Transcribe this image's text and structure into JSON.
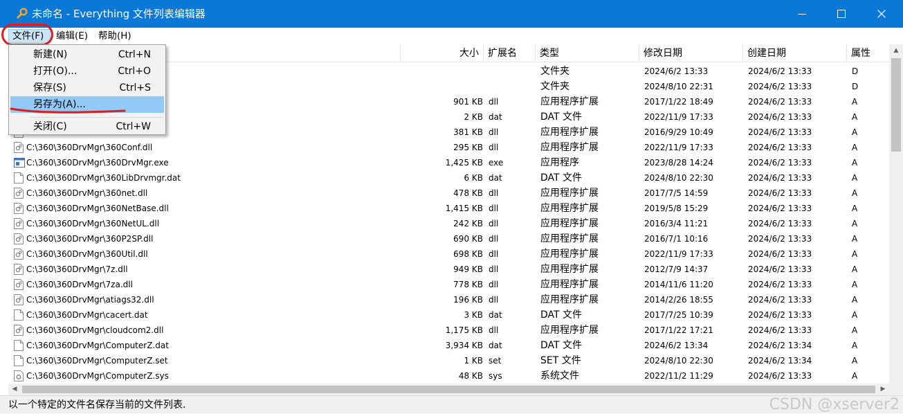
{
  "window": {
    "title": "未命名 - Everything 文件列表编辑器",
    "accent": "#0a78d7"
  },
  "menubar": {
    "items": [
      {
        "label": "文件(F)"
      },
      {
        "label": "编辑(E)"
      },
      {
        "label": "帮助(H)"
      }
    ]
  },
  "file_menu": {
    "items": [
      {
        "label": "新建(N)",
        "shortcut": "Ctrl+N"
      },
      {
        "label": "打开(O)...",
        "shortcut": "Ctrl+O"
      },
      {
        "label": "保存(S)",
        "shortcut": "Ctrl+S"
      },
      {
        "label": "另存为(A)...",
        "shortcut": "",
        "highlighted": true
      },
      {
        "label": "关闭(C)",
        "shortcut": "Ctrl+W"
      }
    ]
  },
  "columns": {
    "size": "大小",
    "ext": "扩展名",
    "type": "类型",
    "modified": "修改日期",
    "created": "创建日期",
    "attr": "属性"
  },
  "rows": [
    {
      "name": "",
      "size": "",
      "ext": "",
      "type": "文件夹",
      "modified": "2024/6/2 13:33",
      "created": "2024/6/2 13:33",
      "attr": "D",
      "icon": "folder-icon"
    },
    {
      "name": "",
      "size": "",
      "ext": "",
      "type": "文件夹",
      "modified": "2024/8/10 22:31",
      "created": "2024/6/2 13:33",
      "attr": "D",
      "icon": "folder-icon"
    },
    {
      "name": "",
      "size": "901 KB",
      "ext": "dll",
      "type": "应用程序扩展",
      "modified": "2017/1/22 18:49",
      "created": "2024/6/2 13:33",
      "attr": "A",
      "icon": "dll-file-icon"
    },
    {
      "name": "",
      "size": "2 KB",
      "ext": "dat",
      "type": "DAT 文件",
      "modified": "2022/11/9 17:33",
      "created": "2024/6/2 13:33",
      "attr": "A",
      "icon": "blank-file-icon"
    },
    {
      "name": "",
      "size": "381 KB",
      "ext": "dll",
      "type": "应用程序扩展",
      "modified": "2016/9/29 10:49",
      "created": "2024/6/2 13:33",
      "attr": "A",
      "icon": "dll-file-icon"
    },
    {
      "name": "C:\\360\\360DrvMgr\\360Conf.dll",
      "size": "295 KB",
      "ext": "dll",
      "type": "应用程序扩展",
      "modified": "2022/11/9 17:33",
      "created": "2024/6/2 13:33",
      "attr": "A",
      "icon": "dll-file-icon"
    },
    {
      "name": "C:\\360\\360DrvMgr\\360DrvMgr.exe",
      "size": "1,425 KB",
      "ext": "exe",
      "type": "应用程序",
      "modified": "2023/8/28 14:24",
      "created": "2024/6/2 13:33",
      "attr": "A",
      "icon": "exe-file-icon"
    },
    {
      "name": "C:\\360\\360DrvMgr\\360LibDrvmgr.dat",
      "size": "6 KB",
      "ext": "dat",
      "type": "DAT 文件",
      "modified": "2024/8/10 22:30",
      "created": "2024/6/2 13:33",
      "attr": "A",
      "icon": "blank-file-icon"
    },
    {
      "name": "C:\\360\\360DrvMgr\\360net.dll",
      "size": "478 KB",
      "ext": "dll",
      "type": "应用程序扩展",
      "modified": "2017/7/5 14:59",
      "created": "2024/6/2 13:33",
      "attr": "A",
      "icon": "dll-file-icon"
    },
    {
      "name": "C:\\360\\360DrvMgr\\360NetBase.dll",
      "size": "1,415 KB",
      "ext": "dll",
      "type": "应用程序扩展",
      "modified": "2019/5/8 15:29",
      "created": "2024/6/2 13:33",
      "attr": "A",
      "icon": "dll-file-icon"
    },
    {
      "name": "C:\\360\\360DrvMgr\\360NetUL.dll",
      "size": "242 KB",
      "ext": "dll",
      "type": "应用程序扩展",
      "modified": "2016/3/4 11:21",
      "created": "2024/6/2 13:33",
      "attr": "A",
      "icon": "dll-file-icon"
    },
    {
      "name": "C:\\360\\360DrvMgr\\360P2SP.dll",
      "size": "690 KB",
      "ext": "dll",
      "type": "应用程序扩展",
      "modified": "2016/7/1 10:16",
      "created": "2024/6/2 13:33",
      "attr": "A",
      "icon": "dll-file-icon"
    },
    {
      "name": "C:\\360\\360DrvMgr\\360Util.dll",
      "size": "698 KB",
      "ext": "dll",
      "type": "应用程序扩展",
      "modified": "2022/11/9 17:33",
      "created": "2024/6/2 13:33",
      "attr": "A",
      "icon": "dll-file-icon"
    },
    {
      "name": "C:\\360\\360DrvMgr\\7z.dll",
      "size": "949 KB",
      "ext": "dll",
      "type": "应用程序扩展",
      "modified": "2012/7/9 14:37",
      "created": "2024/6/2 13:33",
      "attr": "A",
      "icon": "dll-file-icon"
    },
    {
      "name": "C:\\360\\360DrvMgr\\7za.dll",
      "size": "778 KB",
      "ext": "dll",
      "type": "应用程序扩展",
      "modified": "2014/11/6 11:20",
      "created": "2024/6/2 13:33",
      "attr": "A",
      "icon": "dll-file-icon"
    },
    {
      "name": "C:\\360\\360DrvMgr\\atiags32.dll",
      "size": "196 KB",
      "ext": "dll",
      "type": "应用程序扩展",
      "modified": "2014/2/26 18:55",
      "created": "2024/6/2 13:33",
      "attr": "A",
      "icon": "dll-file-icon"
    },
    {
      "name": "C:\\360\\360DrvMgr\\cacert.dat",
      "size": "3 KB",
      "ext": "dat",
      "type": "DAT 文件",
      "modified": "2017/7/25 10:39",
      "created": "2024/6/2 13:33",
      "attr": "A",
      "icon": "blank-file-icon"
    },
    {
      "name": "C:\\360\\360DrvMgr\\cloudcom2.dll",
      "size": "1,175 KB",
      "ext": "dll",
      "type": "应用程序扩展",
      "modified": "2017/1/22 17:21",
      "created": "2024/6/2 13:33",
      "attr": "A",
      "icon": "dll-file-icon"
    },
    {
      "name": "C:\\360\\360DrvMgr\\ComputerZ.dat",
      "size": "3,934 KB",
      "ext": "dat",
      "type": "DAT 文件",
      "modified": "2024/6/2 13:34",
      "created": "2024/6/2 13:34",
      "attr": "A",
      "icon": "blank-file-icon"
    },
    {
      "name": "C:\\360\\360DrvMgr\\ComputerZ.set",
      "size": "1 KB",
      "ext": "set",
      "type": "SET 文件",
      "modified": "2024/8/10 22:30",
      "created": "2024/6/2 13:34",
      "attr": "A",
      "icon": "blank-file-icon"
    },
    {
      "name": "C:\\360\\360DrvMgr\\ComputerZ.sys",
      "size": "48 KB",
      "ext": "sys",
      "type": "系统文件",
      "modified": "2022/11/2 11:29",
      "created": "2024/6/2 13:33",
      "attr": "A",
      "icon": "sys-file-icon"
    }
  ],
  "scrollbars": {
    "vertical_position": 0.0,
    "horizontal_position": 0.0
  },
  "statusbar": {
    "text": "以一个特定的文件名保存当前的文件列表."
  },
  "watermark": "CSDN @xserver2",
  "annotations": {
    "color": "#e11b1b"
  }
}
